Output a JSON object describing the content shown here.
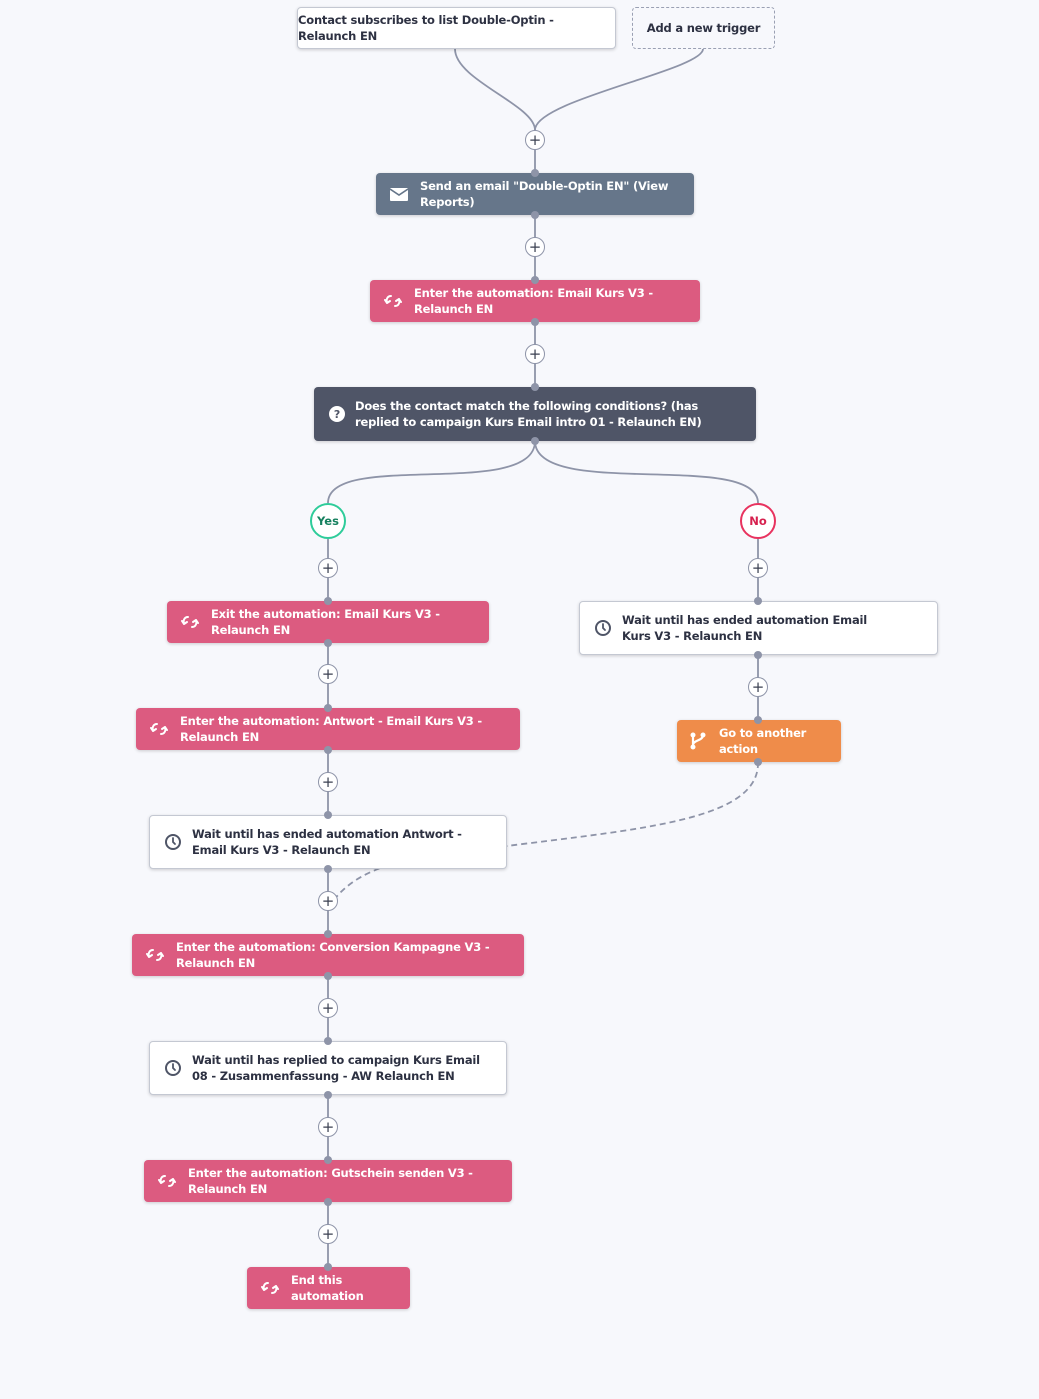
{
  "triggers": {
    "subscribe": "Contact subscribes to list Double-Optin - Relaunch EN",
    "add_new": "Add a new trigger"
  },
  "steps": {
    "send_email": "Send an email \"Double-Optin EN\" (View Reports)",
    "enter_email_kurs": "Enter the automation: Email Kurs V3 - Relaunch EN",
    "condition": "Does the contact match the following conditions? (has replied to campaign Kurs Email intro 01 - Relaunch EN)",
    "exit_email_kurs": "Exit the automation: Email Kurs V3 - Relaunch EN",
    "enter_antwort": "Enter the automation: Antwort - Email Kurs V3 - Relaunch EN",
    "wait_antwort": "Wait until has ended automation Antwort - Email Kurs V3 - Relaunch EN",
    "enter_conversion": "Enter the automation: Conversion Kampagne V3 - Relaunch EN",
    "wait_replied": "Wait until has replied to campaign Kurs Email 08 - Zusammenfassung - AW Relaunch EN",
    "enter_gutschein": "Enter the automation: Gutschein senden V3 - Relaunch EN",
    "end": "End this automation",
    "wait_email_kurs": "Wait until has ended automation Email Kurs V3 - Relaunch EN",
    "goto": "Go to another action"
  },
  "branches": {
    "yes": "Yes",
    "no": "No"
  },
  "add_step_glyph": "+",
  "colors": {
    "background": "#f7f8fc",
    "send_email": "#66768a",
    "condition": "#4f5567",
    "automation": "#dc5b80",
    "goto": "#ef8c4a",
    "yes": "#2ecc9a",
    "no": "#e8335f",
    "wire": "#8e94a8"
  }
}
